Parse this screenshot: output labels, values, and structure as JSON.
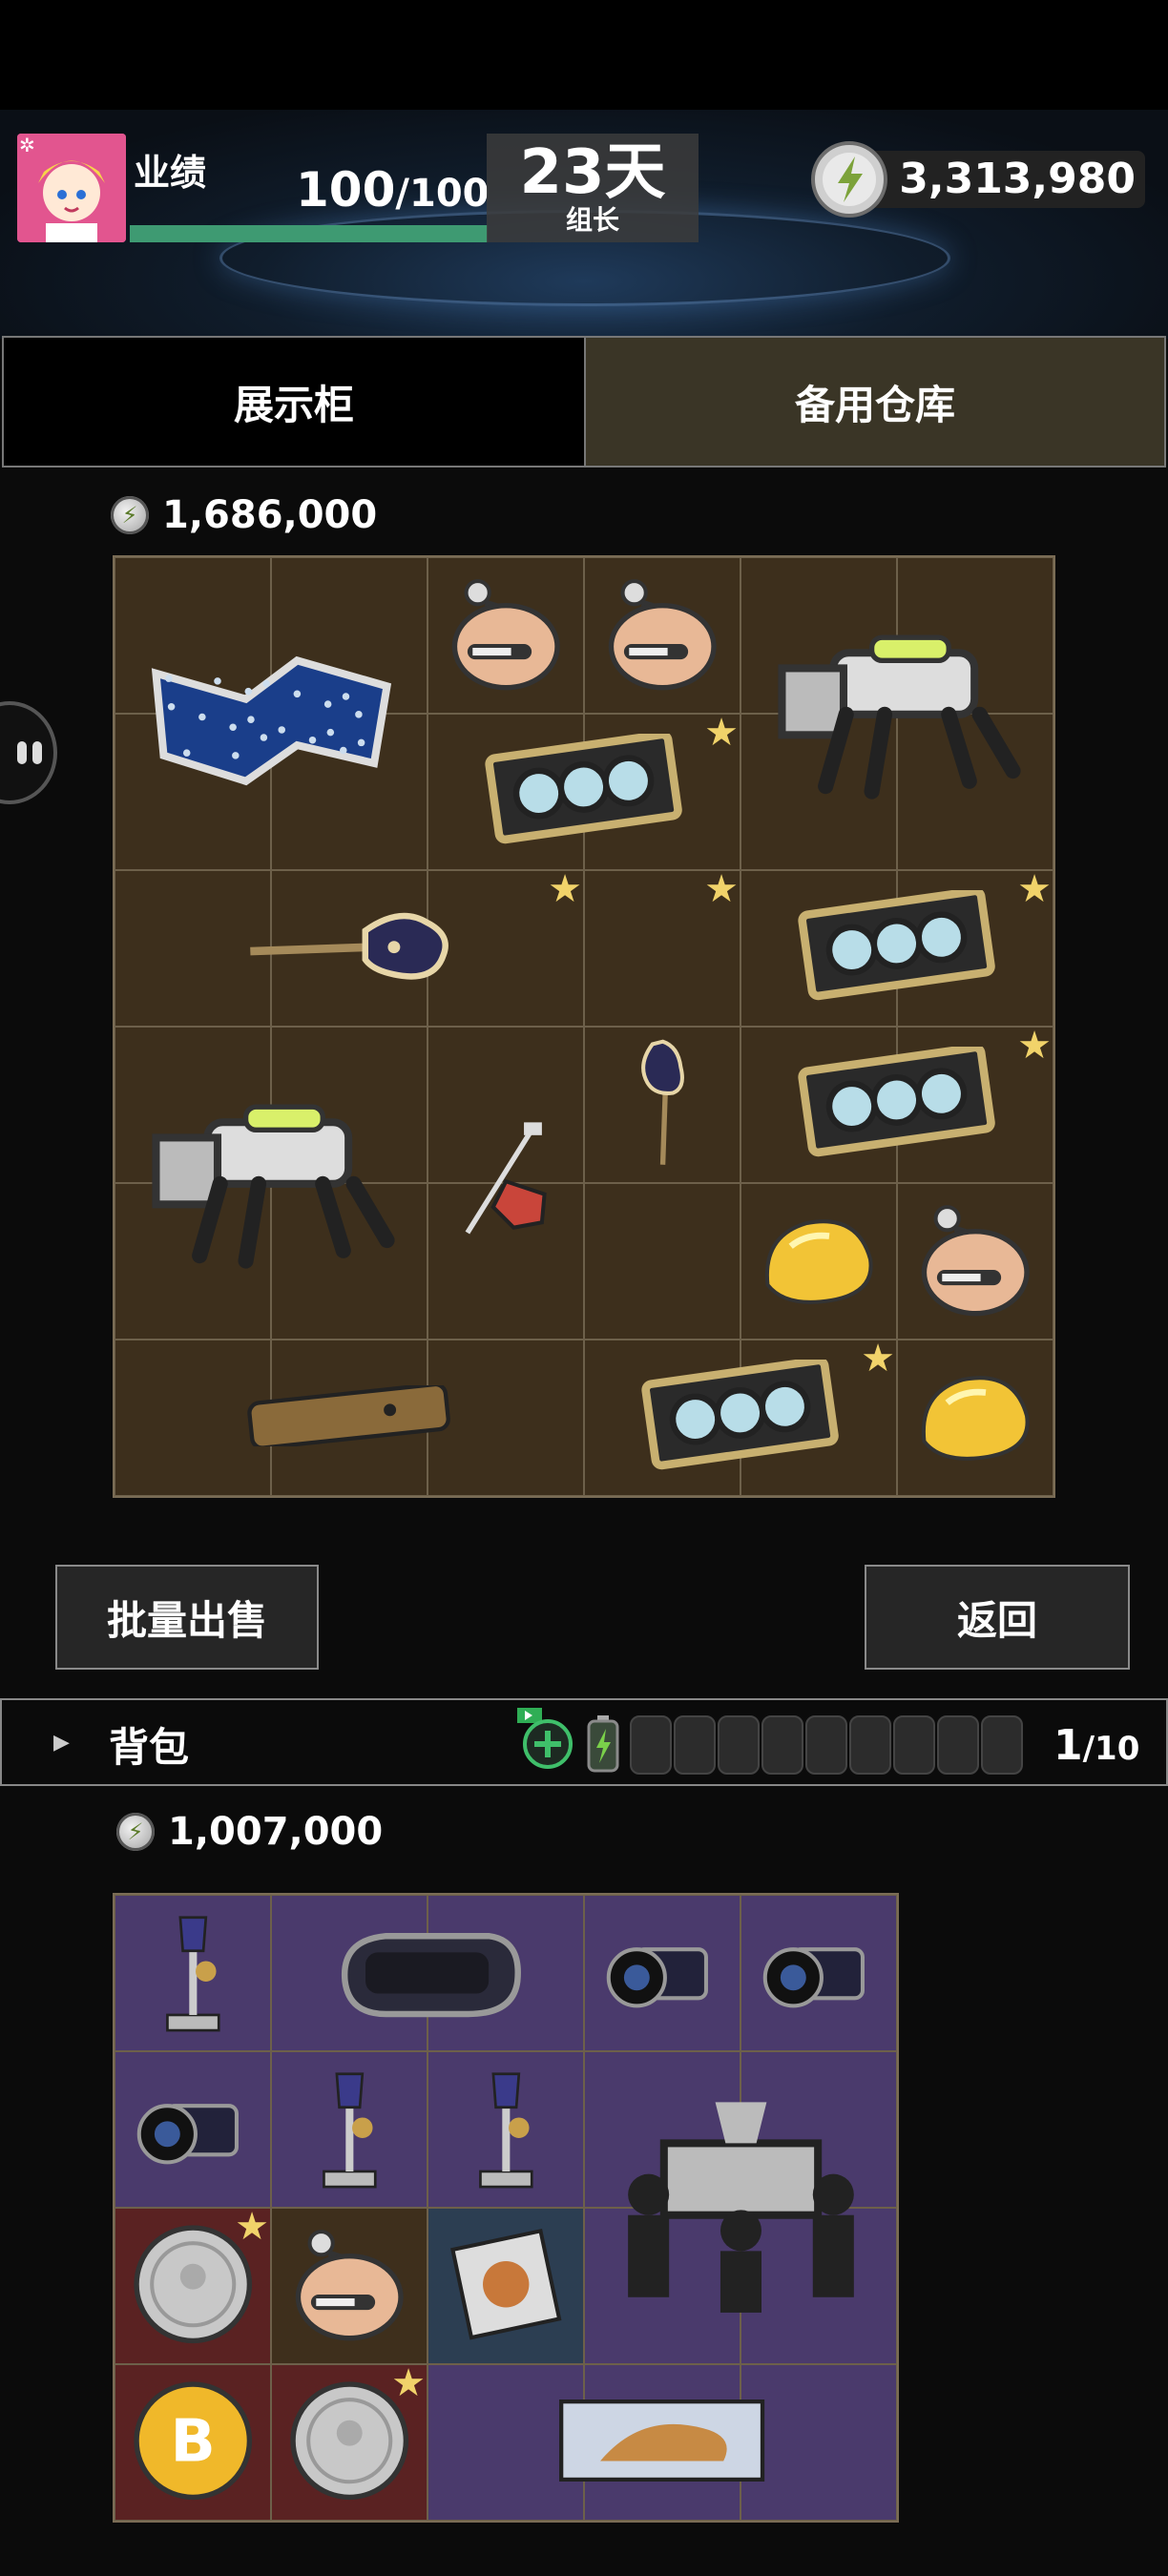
{
  "player": {
    "performance_label": "业绩",
    "performance_current": "100",
    "performance_max": "/100",
    "days": "23天",
    "rank": "组长",
    "currency": "3,313,980"
  },
  "tabs": [
    "展示柜",
    "备用仓库"
  ],
  "showcase": {
    "value": "1,686,000",
    "items": [
      {
        "name": "star-map",
        "icon": "star-map-icon"
      },
      {
        "name": "capsule-robot-head",
        "icon": "robot-head-icon"
      },
      {
        "name": "capsule-robot-head",
        "icon": "robot-head-icon"
      },
      {
        "name": "robot-dog",
        "icon": "robot-dog-icon"
      },
      {
        "name": "graphics-card",
        "icon": "graphics-card-icon",
        "starred": true
      },
      {
        "name": "electric-guitar",
        "icon": "guitar-icon",
        "starred": true
      },
      {
        "name": "electric-guitar",
        "icon": "guitar-icon",
        "starred": true
      },
      {
        "name": "graphics-card",
        "icon": "graphics-card-icon",
        "starred": true
      },
      {
        "name": "graphics-card",
        "icon": "graphics-card-icon",
        "starred": true
      },
      {
        "name": "robot-dog",
        "icon": "robot-dog-icon"
      },
      {
        "name": "gavel-hammer",
        "icon": "hammer-icon"
      },
      {
        "name": "gold-nugget",
        "icon": "gold-nugget-icon"
      },
      {
        "name": "capsule-robot-head",
        "icon": "robot-head-icon"
      },
      {
        "name": "smartphone",
        "icon": "smartphone-icon"
      },
      {
        "name": "graphics-card",
        "icon": "graphics-card-icon",
        "starred": true
      },
      {
        "name": "gold-nugget",
        "icon": "gold-nugget-icon"
      }
    ]
  },
  "buttons": {
    "batch_sell": "批量出售",
    "back": "返回"
  },
  "backpack": {
    "label": "背包",
    "capacity_current": "1",
    "capacity_max": "/10",
    "value": "1,007,000",
    "items": [
      {
        "name": "trophy-statue",
        "icon": "trophy-icon"
      },
      {
        "name": "vr-headset",
        "icon": "vr-headset-icon"
      },
      {
        "name": "camera",
        "icon": "camera-icon"
      },
      {
        "name": "camera",
        "icon": "camera-icon"
      },
      {
        "name": "camera",
        "icon": "camera-icon"
      },
      {
        "name": "trophy-statue",
        "icon": "trophy-icon"
      },
      {
        "name": "trophy-statue",
        "icon": "trophy-icon"
      },
      {
        "name": "coffin-dance-figure",
        "icon": "coffin-dance-icon"
      },
      {
        "name": "silver-coin",
        "icon": "silver-coin-icon",
        "starred": true
      },
      {
        "name": "capsule-robot-head",
        "icon": "robot-head-icon"
      },
      {
        "name": "trading-card",
        "icon": "card-icon"
      },
      {
        "name": "bitcoin",
        "icon": "bitcoin-icon"
      },
      {
        "name": "silver-coin",
        "icon": "silver-coin-icon",
        "starred": true
      },
      {
        "name": "tiger-painting",
        "icon": "painting-icon"
      }
    ]
  },
  "colors": {
    "showcase_bg": "#3d2f1c",
    "backpack_bg": "#4a3a6c",
    "perf_bar": "#3e9a72",
    "star": "#f1d36a"
  }
}
